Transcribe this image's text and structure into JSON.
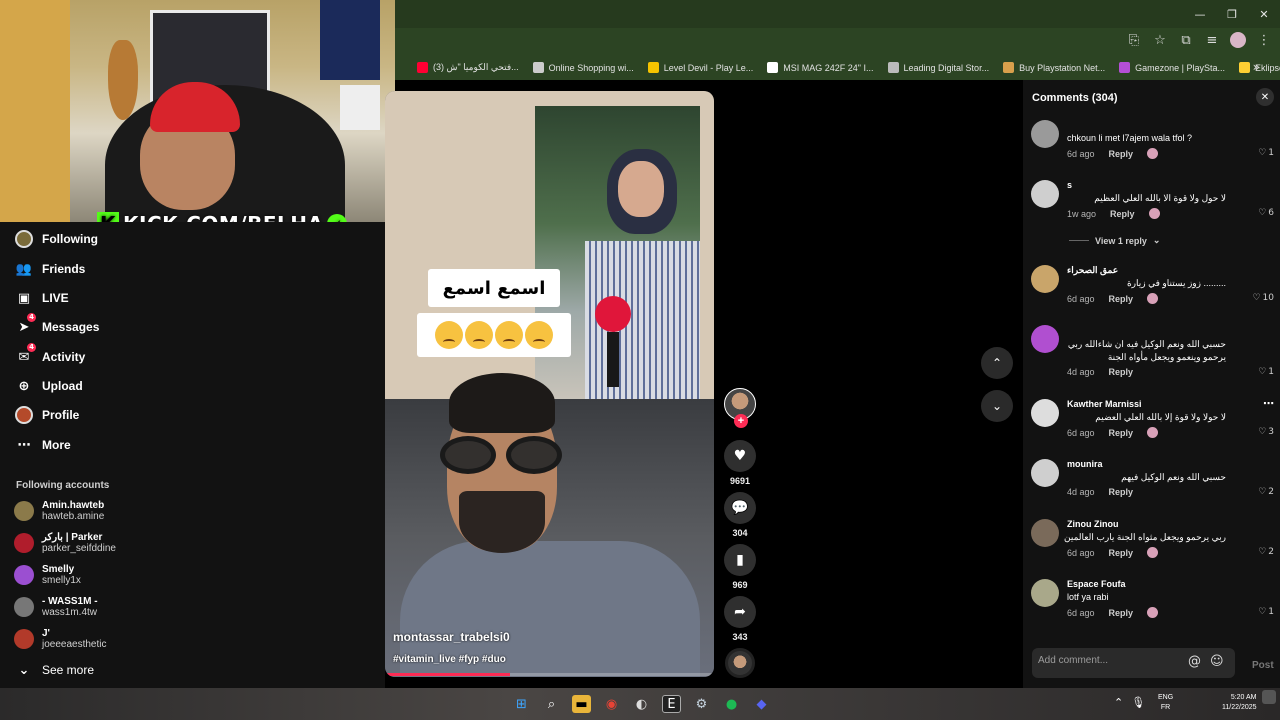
{
  "browser": {
    "bookmarks": [
      {
        "label": "(3) فتحي الكوميا \"ش...",
        "color": "#ff0033"
      },
      {
        "label": "Online Shopping wi...",
        "color": "#cccccc"
      },
      {
        "label": "Level Devil - Play Le...",
        "color": "#f5c300"
      },
      {
        "label": "MSI MAG 242F 24\" I...",
        "color": "#ffffff"
      },
      {
        "label": "Leading Digital Stor...",
        "color": "#bbbbbb"
      },
      {
        "label": "Buy Playstation Net...",
        "color": "#d9a04c"
      },
      {
        "label": "Gamezone | PlaySta...",
        "color": "#b44fd4"
      },
      {
        "label": "Eklipse - Convert Tw...",
        "color": "#ffcf33"
      }
    ]
  },
  "webcam": {
    "kick_text": "KICK.COM/BELHA"
  },
  "sidebar": {
    "nav": [
      {
        "label": "Following",
        "icon": "following-avatar-icon"
      },
      {
        "label": "Friends",
        "icon": "friends-icon"
      },
      {
        "label": "LIVE",
        "icon": "live-icon"
      },
      {
        "label": "Messages",
        "icon": "messages-icon",
        "badge": "4"
      },
      {
        "label": "Activity",
        "icon": "activity-icon",
        "badge": "4"
      },
      {
        "label": "Upload",
        "icon": "upload-icon"
      },
      {
        "label": "Profile",
        "icon": "profile-icon"
      },
      {
        "label": "More",
        "icon": "more-icon"
      }
    ],
    "following_title": "Following accounts",
    "accounts": [
      {
        "name": "Amin.hawteb",
        "handle": "hawteb.amine",
        "color": "#8b7a4a"
      },
      {
        "name": "باركر | Parker",
        "handle": "parker_seifddine",
        "color": "#b01d2c"
      },
      {
        "name": "Smelly",
        "handle": "smelly1x",
        "color": "#9b4fd1"
      },
      {
        "name": "- WASS1M -",
        "handle": "wass1m.4tw",
        "color": "#777777"
      },
      {
        "name": "J'",
        "handle": "joeeeaesthetic",
        "color": "#b23a2a"
      }
    ],
    "see_more": "See more"
  },
  "video": {
    "caption_arabic": "اسمع  اسمع",
    "author": "montassar_trabelsi0",
    "tags": "#vitamin_live #fyp #duo",
    "progress": 0.38,
    "likes": "9691",
    "comments": "304",
    "saves": "969",
    "shares": "343"
  },
  "comments_panel": {
    "title": "Comments (304)",
    "view_replies": "View 1 reply",
    "input_placeholder": "Add comment...",
    "post_label": "Post",
    "items": [
      {
        "name": "",
        "text": "chkoun li met l7ajem wala tfol ?",
        "time": "6d ago",
        "reply": "Reply",
        "likes": "1",
        "rtl": false,
        "color": "#9a9a9a"
      },
      {
        "name": "s",
        "text": "لا حول ولا قوة الا بالله العلي العظيم",
        "time": "1w ago",
        "reply": "Reply",
        "likes": "6",
        "rtl": true,
        "color": "#cfcfcf"
      },
      {
        "name": "عمق الصحراء",
        "text": "......... زوز يستناو في زيارة",
        "time": "6d ago",
        "reply": "Reply",
        "likes": "10",
        "rtl": true,
        "color": "#c9a56a"
      },
      {
        "name": "",
        "text": "حسبي الله ونعم الوكيل فيه ان شاءالله ربي يرحمو وينعمو ويجعل مأواه الجنة",
        "time": "4d ago",
        "reply": "Reply",
        "likes": "1",
        "rtl": true,
        "color": "#b04fd0"
      },
      {
        "name": "Kawther Marnissi",
        "text": "لا حولا ولا قوة إلا بالله العلي العضيم",
        "time": "6d ago",
        "reply": "Reply",
        "likes": "3",
        "rtl": true,
        "color": "#dddddd"
      },
      {
        "name": "mounira",
        "text": "حسبي الله ونعم الوكيل فيهم",
        "time": "4d ago",
        "reply": "Reply",
        "likes": "2",
        "rtl": true,
        "color": "#cfcfcf"
      },
      {
        "name": "Zinou Zinou",
        "text": "ربي يرحمو ويجعل مثواه الجنة يارب العالمين",
        "time": "6d ago",
        "reply": "Reply",
        "likes": "2",
        "rtl": true,
        "color": "#7a6a5a"
      },
      {
        "name": "Espace Foufa",
        "text": "lotf ya rabi",
        "time": "6d ago",
        "reply": "Reply",
        "likes": "1",
        "rtl": false,
        "color": "#a9a88a"
      }
    ]
  },
  "taskbar": {
    "lang_top": "ENG",
    "lang_bottom": "FR",
    "time": "5:20 AM",
    "date": "11/22/2025"
  }
}
